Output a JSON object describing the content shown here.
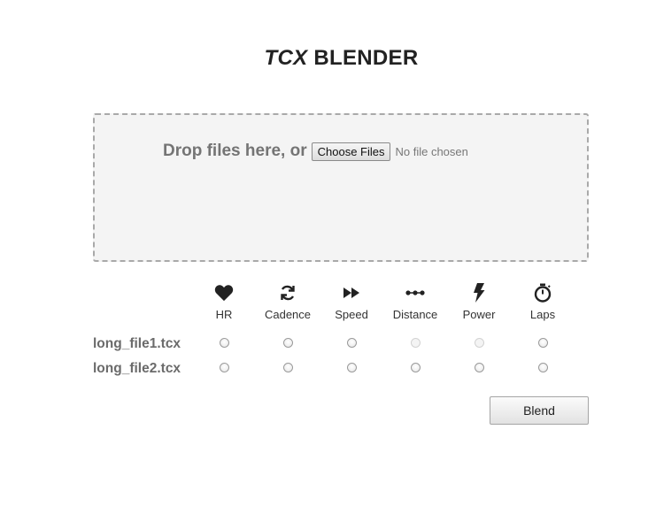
{
  "title": {
    "italic": "TCX",
    "rest": " BLENDER"
  },
  "dropzone": {
    "text": "Drop files here, or",
    "choose_label": "Choose Files",
    "no_file_text": "No file chosen"
  },
  "columns": [
    {
      "label": "HR",
      "icon": "heart-icon"
    },
    {
      "label": "Cadence",
      "icon": "refresh-icon"
    },
    {
      "label": "Speed",
      "icon": "fast-forward-icon"
    },
    {
      "label": "Distance",
      "icon": "distance-dots-icon"
    },
    {
      "label": "Power",
      "icon": "lightning-bolt-icon"
    },
    {
      "label": "Laps",
      "icon": "stopwatch-icon"
    }
  ],
  "files": [
    {
      "name": "long_file1.tcx",
      "enabled": [
        true,
        true,
        true,
        false,
        false,
        true
      ]
    },
    {
      "name": "long_file2.tcx",
      "enabled": [
        true,
        true,
        true,
        true,
        true,
        true
      ]
    }
  ],
  "blend_label": "Blend"
}
